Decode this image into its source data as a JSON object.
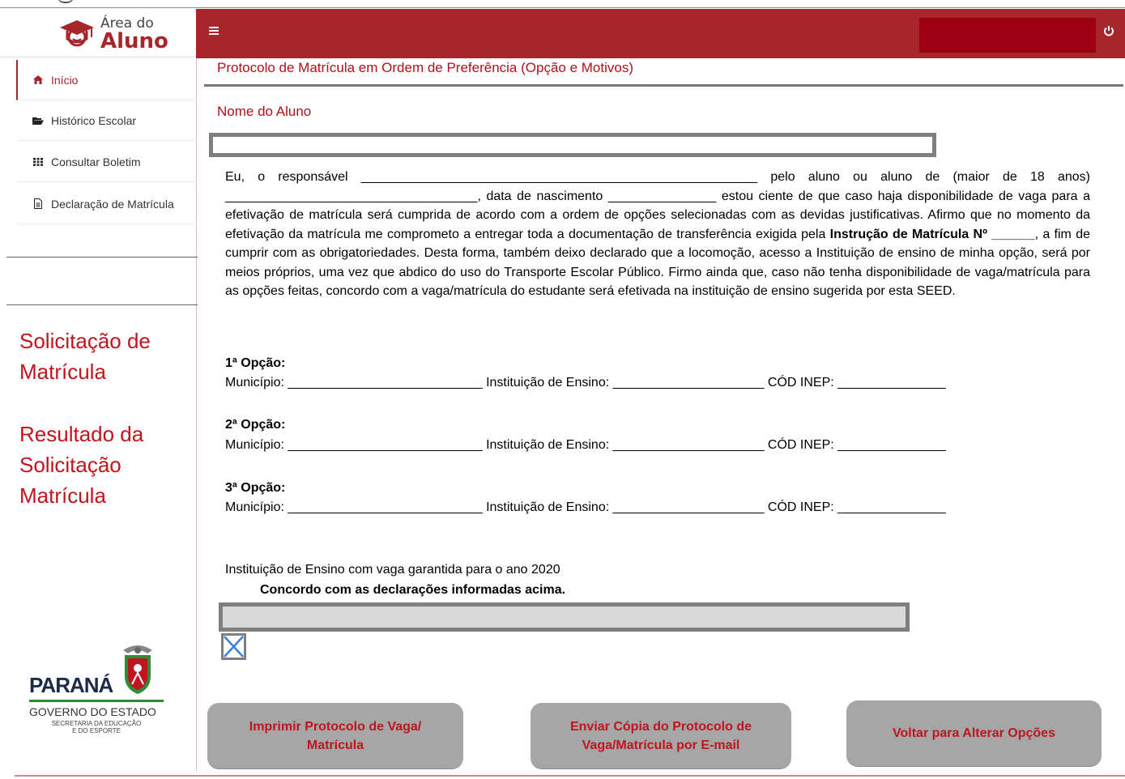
{
  "header": {
    "logo_line1": "Área do",
    "logo_line2": "Aluno",
    "colors": {
      "brand": "#a6262c",
      "user_box": "#9c0015",
      "link": "#c0141e"
    }
  },
  "sidebar": {
    "items": [
      {
        "label": "Início",
        "icon": "home-icon"
      },
      {
        "label": "Histórico Escolar",
        "icon": "folder-open-icon"
      },
      {
        "label": "Consultar Boletim",
        "icon": "table-icon"
      },
      {
        "label": "Declaração de Matrícula",
        "icon": "file-icon"
      }
    ],
    "link1_l1": "Solicitação de",
    "link1_l2": "Matrícula",
    "link2_l1": "Resultado da",
    "link2_l2": "Solicitação",
    "link2_l3": "Matrícula",
    "footer": {
      "brand": "PARANÁ",
      "gov": "GOVERNO DO ESTADO",
      "sec1": "SECRETARIA DA EDUCAÇÃO",
      "sec2": "E DO ESPORTE"
    }
  },
  "main": {
    "title": "Protocolo de Matrícula em Ordem de Preferência (Opção e Motivos)",
    "student_label": "Nome do Aluno",
    "declaration": {
      "p1": "Eu, o responsável _______________________________________________________ pelo aluno ou aluno de (maior de 18 anos) ___________________________________, data de nascimento _______________ estou ciente de que caso haja disponibilidade de vaga para a efetivação de matrícula será cumprida de acordo com a ordem de opções selecionadas com as devidas justificativas. Afirmo que no momento da efetivação da matrícula me comprometo a entregar toda a documentação de transferência exigida pela ",
      "bold": "Instrução de Matrícula Nº ______",
      "p2": ", a fim de cumprir com as obrigatoriedades. Desta forma, também deixo declarado que a locomoção, acesso a Instituição de ensino de minha opção, será por meios próprios, uma vez que abdico do uso do Transporte Escolar Público. Firmo ainda que, caso não tenha disponibilidade de vaga/matrícula para as opções feitas,  concordo com a vaga/matrícula do estudante será efetivada na instituição de ensino sugerida por esta SEED."
    },
    "options": [
      {
        "heading": "1ª Opção:",
        "row": "Município: ___________________________ Instituição de Ensino: _____________________ CÓD INEP: _______________"
      },
      {
        "heading": "2ª Opção:",
        "row": "Município: ___________________________ Instituição de Ensino: _____________________ CÓD INEP: _______________"
      },
      {
        "heading": "3ª Opção:",
        "row": "Município: ___________________________ Instituição de Ensino: _____________________ CÓD INEP: _______________"
      }
    ],
    "vaga_text": "Instituição de Ensino com vaga garantida para o ano 2020",
    "agree_text": "Concordo com as declarações informadas acima.",
    "buttons": {
      "print_l1": "Imprimir Protocolo de Vaga/",
      "print_l2": "Matrícula",
      "email_l1": "Enviar Cópia do Protocolo de",
      "email_l2": "Vaga/Matrícula por E-mail",
      "back": "Voltar para Alterar Opções"
    }
  }
}
